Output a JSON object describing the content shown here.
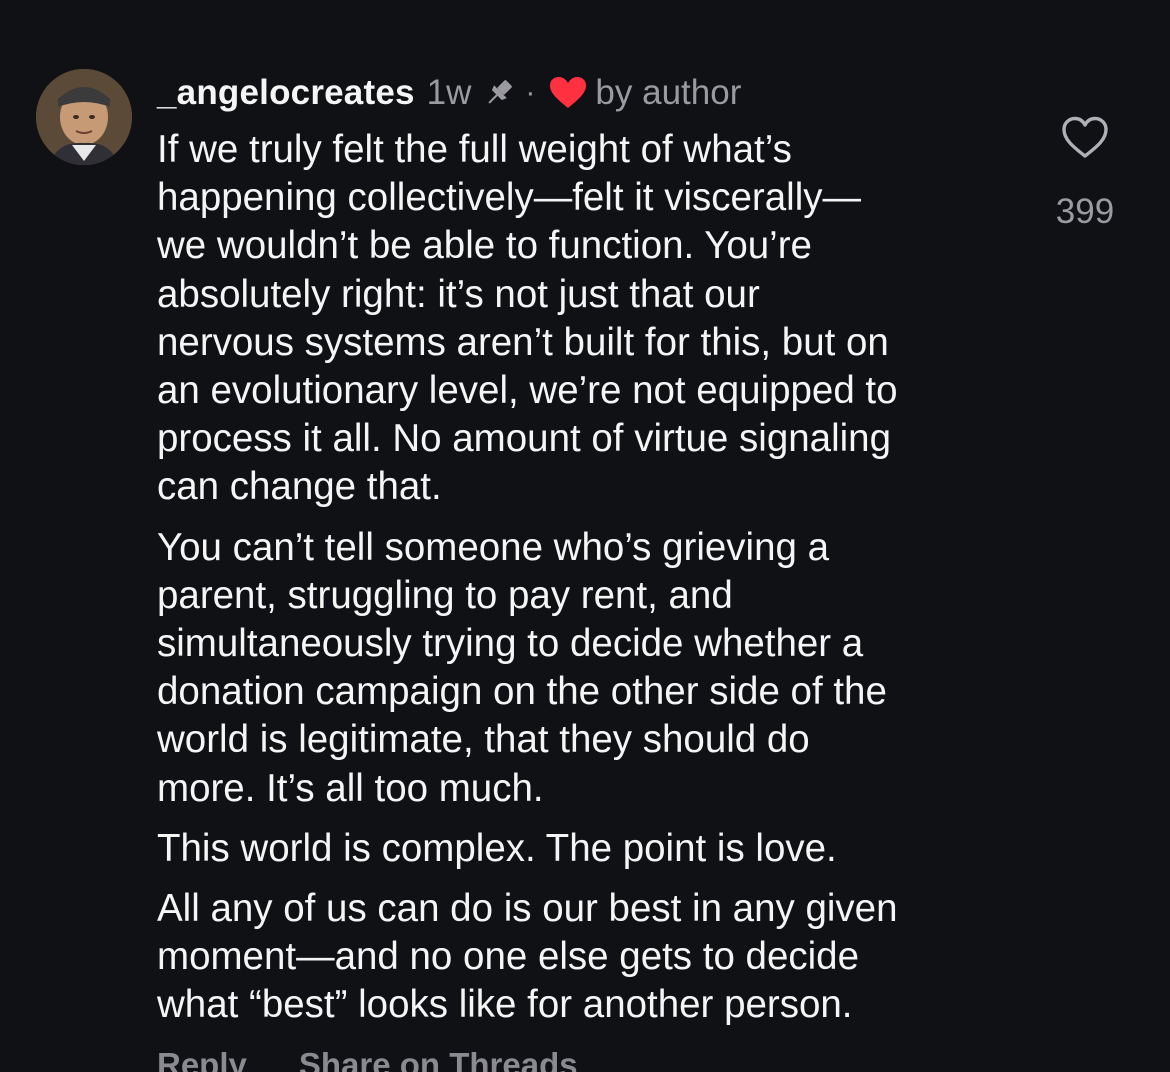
{
  "comment": {
    "username": "_angelocreates",
    "time": "1w",
    "separator": "·",
    "liked_by": "by author",
    "paragraphs": [
      "If we truly felt the full weight of what’s\nhappening collectively—felt it viscerally—\nwe wouldn’t be able to function. You’re\nabsolutely right: it’s not just that our\nnervous systems aren’t built for this, but on\nan evolutionary level, we’re not equipped to\nprocess it all. No amount of virtue signaling\ncan change that.",
      "You can’t tell someone who’s grieving a\nparent, struggling to pay rent, and\nsimultaneously trying to decide whether a\ndonation campaign on the other side of the\nworld is legitimate, that they should do\nmore. It’s all too much.",
      "This world is complex. The point is love.",
      "All any of us can do is our best in any given\nmoment—and no one else gets to decide\nwhat “best” looks like for another person."
    ],
    "like_count": "399",
    "actions": {
      "reply": "Reply",
      "share": "Share on Threads"
    }
  },
  "colors": {
    "background": "#0f1115",
    "text": "#f5f5f5",
    "muted": "#9a9aa0",
    "heart_red": "#ff3040"
  },
  "icons": {
    "pin": "pin-icon",
    "liked_heart": "heart-filled-icon",
    "like": "heart-outline-icon"
  }
}
